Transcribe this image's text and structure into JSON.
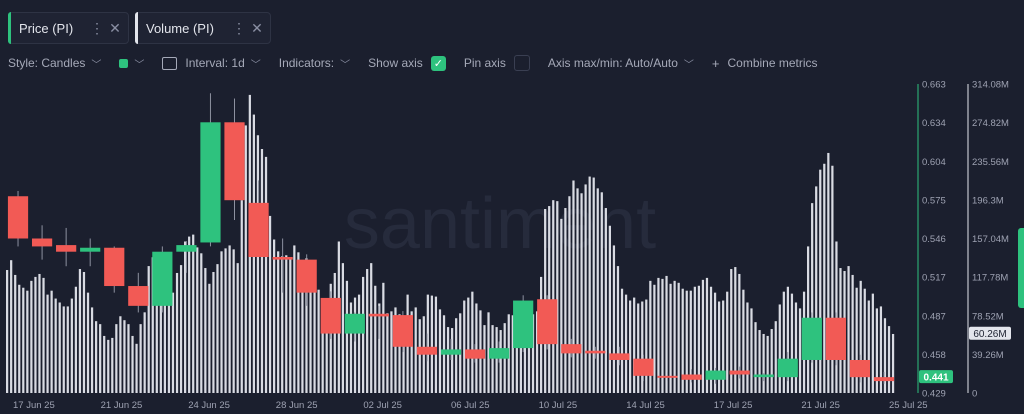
{
  "tabs": [
    {
      "label": "Price (PI)",
      "color": "#2ec27e",
      "active": true
    },
    {
      "label": "Volume (PI)",
      "color": "#e3e5ec",
      "active": false
    }
  ],
  "toolbar": {
    "style_label": "Style: Candles",
    "color_swatch": "#2ec27e",
    "interval_label": "Interval: 1d",
    "indicators_label": "Indicators:",
    "show_axis_label": "Show axis",
    "show_axis_checked": true,
    "pin_axis_label": "Pin axis",
    "pin_axis_checked": false,
    "axis_range_label": "Axis max/min: Auto/Auto",
    "combine_label": "Combine metrics"
  },
  "watermark": "santiment",
  "chart_data": {
    "type": "candlestick+bar",
    "price_axis": {
      "ticks": [
        "0.663",
        "0.634",
        "0.604",
        "0.575",
        "0.546",
        "0.517",
        "0.487",
        "0.458",
        "0.429"
      ],
      "range": [
        0.429,
        0.663
      ],
      "current": "0.441",
      "color": "#2ec27e"
    },
    "volume_axis": {
      "ticks": [
        "314.08M",
        "274.82M",
        "235.56M",
        "196.3M",
        "157.04M",
        "117.78M",
        "78.52M",
        "39.26M",
        "0"
      ],
      "range": [
        0,
        314.08
      ],
      "current": "60.26M",
      "unit": "M"
    },
    "x_tick_labels": [
      "17 Jun 25",
      "21 Jun 25",
      "24 Jun 25",
      "28 Jun 25",
      "02 Jul 25",
      "06 Jul 25",
      "10 Jul 25",
      "14 Jul 25",
      "17 Jul 25",
      "21 Jul 25",
      "25 Jul 25"
    ],
    "candles": [
      {
        "o": 0.578,
        "h": 0.582,
        "l": 0.54,
        "c": 0.546
      },
      {
        "o": 0.546,
        "h": 0.556,
        "l": 0.53,
        "c": 0.54
      },
      {
        "o": 0.541,
        "h": 0.554,
        "l": 0.525,
        "c": 0.536
      },
      {
        "o": 0.536,
        "h": 0.546,
        "l": 0.525,
        "c": 0.539
      },
      {
        "o": 0.539,
        "h": 0.54,
        "l": 0.505,
        "c": 0.51
      },
      {
        "o": 0.51,
        "h": 0.52,
        "l": 0.49,
        "c": 0.495
      },
      {
        "o": 0.495,
        "h": 0.54,
        "l": 0.49,
        "c": 0.536
      },
      {
        "o": 0.536,
        "h": 0.544,
        "l": 0.52,
        "c": 0.541
      },
      {
        "o": 0.543,
        "h": 0.656,
        "l": 0.54,
        "c": 0.634
      },
      {
        "o": 0.634,
        "h": 0.652,
        "l": 0.56,
        "c": 0.575
      },
      {
        "o": 0.573,
        "h": 0.59,
        "l": 0.56,
        "c": 0.532
      },
      {
        "o": 0.532,
        "h": 0.546,
        "l": 0.505,
        "c": 0.53
      },
      {
        "o": 0.53,
        "h": 0.534,
        "l": 0.495,
        "c": 0.505
      },
      {
        "o": 0.501,
        "h": 0.506,
        "l": 0.47,
        "c": 0.474
      },
      {
        "o": 0.474,
        "h": 0.49,
        "l": 0.468,
        "c": 0.489
      },
      {
        "o": 0.489,
        "h": 0.495,
        "l": 0.47,
        "c": 0.487
      },
      {
        "o": 0.488,
        "h": 0.491,
        "l": 0.46,
        "c": 0.464
      },
      {
        "o": 0.464,
        "h": 0.474,
        "l": 0.453,
        "c": 0.458
      },
      {
        "o": 0.458,
        "h": 0.47,
        "l": 0.454,
        "c": 0.462
      },
      {
        "o": 0.462,
        "h": 0.466,
        "l": 0.452,
        "c": 0.455
      },
      {
        "o": 0.455,
        "h": 0.468,
        "l": 0.452,
        "c": 0.463
      },
      {
        "o": 0.463,
        "h": 0.503,
        "l": 0.46,
        "c": 0.499
      },
      {
        "o": 0.5,
        "h": 0.503,
        "l": 0.462,
        "c": 0.466
      },
      {
        "o": 0.466,
        "h": 0.47,
        "l": 0.456,
        "c": 0.459
      },
      {
        "o": 0.461,
        "h": 0.464,
        "l": 0.455,
        "c": 0.459
      },
      {
        "o": 0.459,
        "h": 0.464,
        "l": 0.45,
        "c": 0.454
      },
      {
        "o": 0.455,
        "h": 0.458,
        "l": 0.438,
        "c": 0.442
      },
      {
        "o": 0.442,
        "h": 0.445,
        "l": 0.438,
        "c": 0.441
      },
      {
        "o": 0.443,
        "h": 0.447,
        "l": 0.437,
        "c": 0.439
      },
      {
        "o": 0.439,
        "h": 0.448,
        "l": 0.436,
        "c": 0.446
      },
      {
        "o": 0.446,
        "h": 0.449,
        "l": 0.44,
        "c": 0.443
      },
      {
        "o": 0.441,
        "h": 0.444,
        "l": 0.438,
        "c": 0.443
      },
      {
        "o": 0.441,
        "h": 0.46,
        "l": 0.438,
        "c": 0.455
      },
      {
        "o": 0.454,
        "h": 0.49,
        "l": 0.452,
        "c": 0.486
      },
      {
        "o": 0.486,
        "h": 0.49,
        "l": 0.45,
        "c": 0.454
      },
      {
        "o": 0.454,
        "h": 0.458,
        "l": 0.437,
        "c": 0.441
      },
      {
        "o": 0.441,
        "h": 0.445,
        "l": 0.436,
        "c": 0.438
      }
    ],
    "volume_M": [
      125,
      135,
      120,
      110,
      107,
      104,
      114,
      118,
      121,
      117,
      100,
      104,
      96,
      92,
      88,
      88,
      96,
      108,
      126,
      123,
      102,
      87,
      73,
      70,
      58,
      54,
      56,
      70,
      78,
      74,
      70,
      58,
      50,
      70,
      82,
      129,
      138,
      120,
      109,
      122,
      112,
      102,
      122,
      130,
      154,
      159,
      161,
      148,
      142,
      127,
      111,
      123,
      131,
      144,
      147,
      150,
      146,
      132,
      196,
      272,
      303,
      283,
      262,
      248,
      240,
      180,
      156,
      144,
      139,
      140,
      137,
      150,
      143,
      135,
      137,
      130,
      131,
      105,
      86,
      84,
      111,
      122,
      154,
      132,
      114,
      92,
      97,
      100,
      118,
      126,
      132,
      109,
      91,
      112,
      81,
      83,
      87,
      80,
      71,
      100,
      83,
      87,
      75,
      78,
      100,
      99,
      98,
      85,
      79,
      67,
      66,
      76,
      81,
      94,
      97,
      103,
      91,
      84,
      69,
      82,
      69,
      67,
      64,
      71,
      80,
      79,
      93,
      82,
      78,
      76,
      80,
      83,
      118,
      187,
      190,
      196,
      195,
      177,
      188,
      200,
      216,
      208,
      203,
      212,
      220,
      219,
      208,
      204,
      188,
      170,
      150,
      129,
      106,
      100,
      94,
      97,
      91,
      93,
      95,
      114,
      110,
      117,
      116,
      119,
      111,
      114,
      112,
      106,
      104,
      104,
      108,
      109,
      115,
      117,
      108,
      102,
      93,
      94,
      103,
      126,
      128,
      121,
      105,
      92,
      86,
      72,
      64,
      60,
      58,
      65,
      73,
      90,
      103,
      108,
      101,
      92,
      86,
      103,
      149,
      193,
      210,
      227,
      233,
      244,
      231,
      154,
      127,
      124,
      129,
      120,
      107,
      114,
      106,
      94,
      101,
      86,
      88,
      76,
      68,
      60
    ]
  }
}
